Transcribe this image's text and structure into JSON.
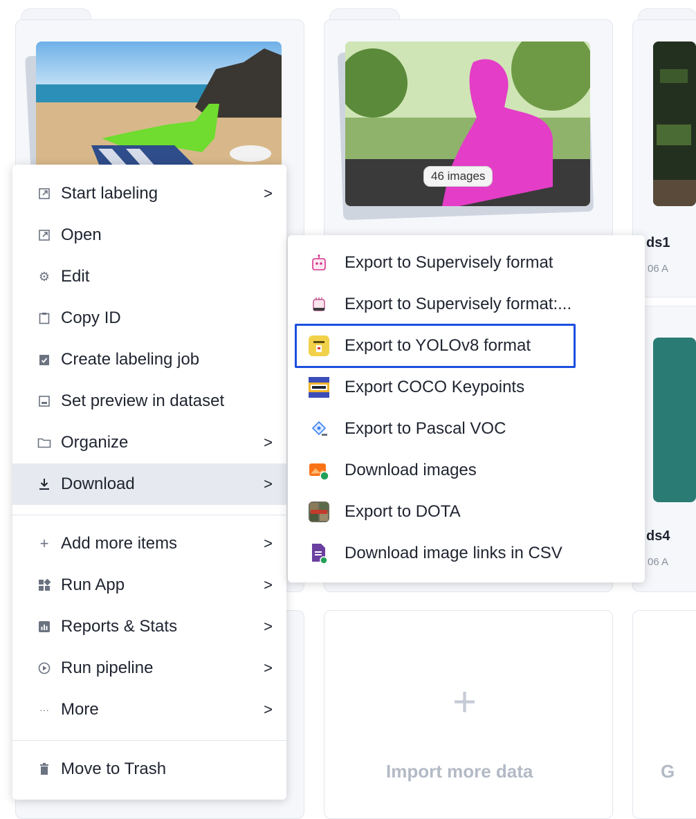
{
  "cards": {
    "card1": {
      "badge": ""
    },
    "card2": {
      "badge": "46 images"
    },
    "card3": {
      "title": "ds1",
      "sub": "06 A"
    },
    "card4": {
      "title": "ds4",
      "sub": "06 A"
    },
    "import": {
      "label": "Import more data",
      "plus": "+"
    },
    "card6": {
      "label": "G"
    }
  },
  "context_menu": {
    "items": [
      {
        "label": "Start labeling",
        "icon": "external-link-icon",
        "chevron": ">"
      },
      {
        "label": "Open",
        "icon": "external-link-icon"
      },
      {
        "label": "Edit",
        "icon": "gear-icon"
      },
      {
        "label": "Copy ID",
        "icon": "clipboard-icon"
      },
      {
        "label": "Create labeling job",
        "icon": "clipboard-check-icon"
      },
      {
        "label": "Set preview in dataset",
        "icon": "image-icon"
      },
      {
        "label": "Organize",
        "icon": "folder-icon",
        "chevron": ">"
      },
      {
        "label": "Download",
        "icon": "download-icon",
        "chevron": ">"
      },
      {
        "label": "Add more items",
        "icon": "plus-icon",
        "chevron": ">"
      },
      {
        "label": "Run App",
        "icon": "apps-icon",
        "chevron": ">"
      },
      {
        "label": "Reports & Stats",
        "icon": "chart-icon",
        "chevron": ">"
      },
      {
        "label": "Run pipeline",
        "icon": "play-circle-icon",
        "chevron": ">"
      },
      {
        "label": "More",
        "icon": "ellipsis-icon",
        "chevron": ">"
      },
      {
        "label": "Move to Trash",
        "icon": "trash-icon"
      }
    ]
  },
  "download_submenu": {
    "items": [
      {
        "label": "Export to Supervisely format",
        "icon": "robot-icon"
      },
      {
        "label": "Export to Supervisely format:...",
        "icon": "robot-icon"
      },
      {
        "label": "Export to YOLOv8 format",
        "icon": "yolo-icon"
      },
      {
        "label": "Export COCO Keypoints",
        "icon": "coco-icon"
      },
      {
        "label": "Export to Pascal VOC",
        "icon": "pascal-icon"
      },
      {
        "label": "Download images",
        "icon": "images-download-icon"
      },
      {
        "label": "Export to DOTA",
        "icon": "dota-icon"
      },
      {
        "label": "Download image links in CSV",
        "icon": "csv-icon"
      }
    ]
  },
  "colors": {
    "highlight": "#1b4fe0",
    "active_row": "#e6e9ef"
  }
}
